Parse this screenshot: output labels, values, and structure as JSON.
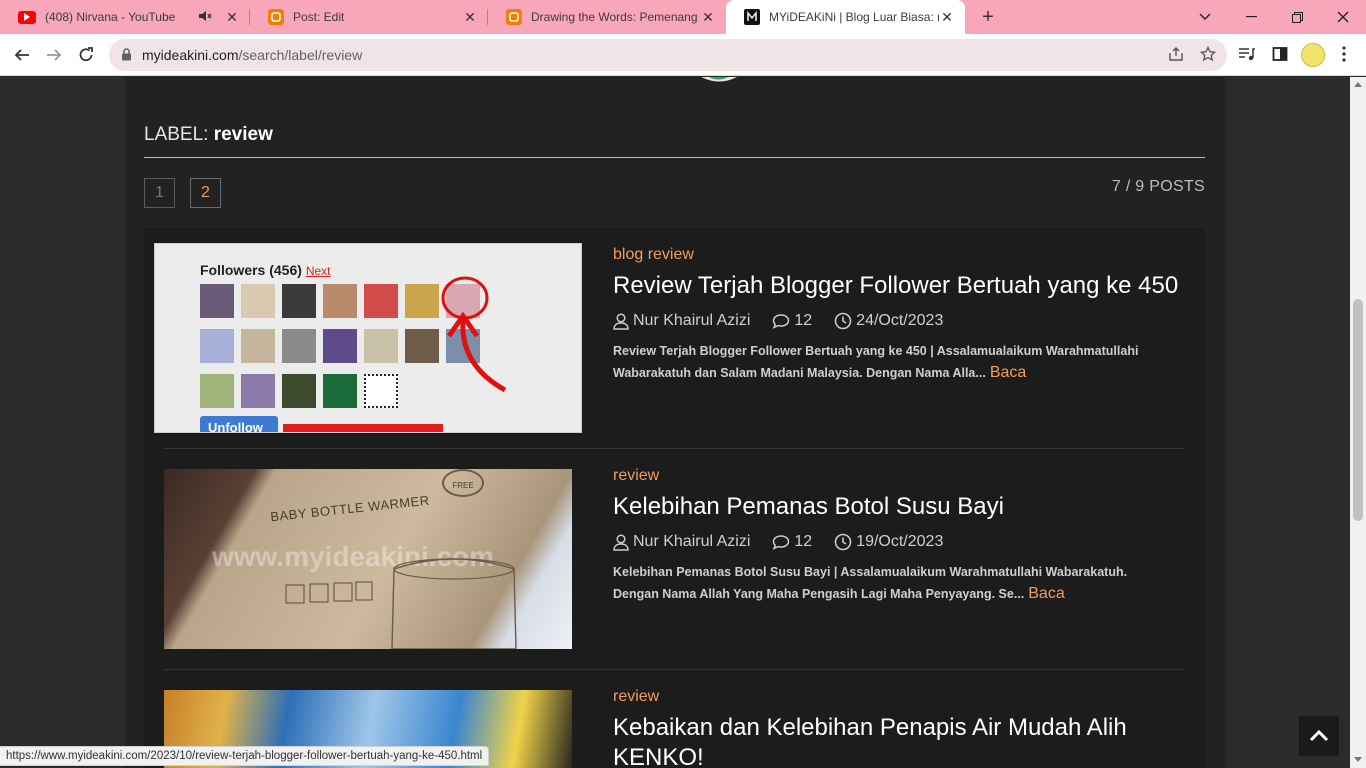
{
  "browser": {
    "tabs": [
      {
        "title": "(408) Nirvana - YouTube",
        "icon": "youtube-icon",
        "muted": true,
        "active": false
      },
      {
        "title": "Post: Edit",
        "icon": "blogger-icon",
        "active": false
      },
      {
        "title": "Drawing the Words: Pemenang S",
        "icon": "blogger-icon",
        "active": false
      },
      {
        "title": "MYiDEAKiNi | Blog Luar Biasa: re",
        "icon": "myideakini-icon",
        "active": true
      }
    ],
    "url_host": "myideakini.com",
    "url_path": "/search/label/review",
    "status_url": "https://www.myideakini.com/2023/10/review-terjah-blogger-follower-bertuah-yang-ke-450.html",
    "colors": {
      "tabbar": "#f8a7ba",
      "omnibox": "#f1e4e7"
    }
  },
  "page": {
    "label_prefix": "LABEL:",
    "label_name": "review",
    "pager": [
      "1",
      "2"
    ],
    "post_count": "7 / 9 POSTS",
    "accent": "#f39c5a",
    "thumb1": {
      "header": "Followers (456)",
      "next": "Next",
      "unfollow": "Unfollow"
    },
    "thumb2": {
      "box_text": "BABY BOTTLE WARMER",
      "watermark": "www.myideakini.com",
      "badge": "FREE"
    }
  },
  "posts": [
    {
      "category": "blog review",
      "title": "Review Terjah Blogger Follower Bertuah yang ke 450",
      "author": "Nur Khairul Azizi",
      "comments": "12",
      "date": "24/Oct/2023",
      "excerpt": "Review Terjah Blogger Follower Bertuah yang ke 450 | Assalamualaikum Warahmatullahi Wabarakatuh dan Salam Madani Malaysia.  Dengan Nama Alla...",
      "more": "Baca"
    },
    {
      "category": "review",
      "title": "Kelebihan Pemanas Botol Susu Bayi",
      "author": "Nur Khairul Azizi",
      "comments": "12",
      "date": "19/Oct/2023",
      "excerpt": "Kelebihan Pemanas Botol Susu Bayi | Assalamualaikum Warahmatullahi Wabarakatuh. Dengan Nama Allah Yang Maha Pengasih Lagi Maha Penyayang. Se...",
      "more": "Baca"
    },
    {
      "category": "review",
      "title": "Kebaikan dan Kelebihan Penapis Air Mudah Alih KENKO!"
    }
  ]
}
